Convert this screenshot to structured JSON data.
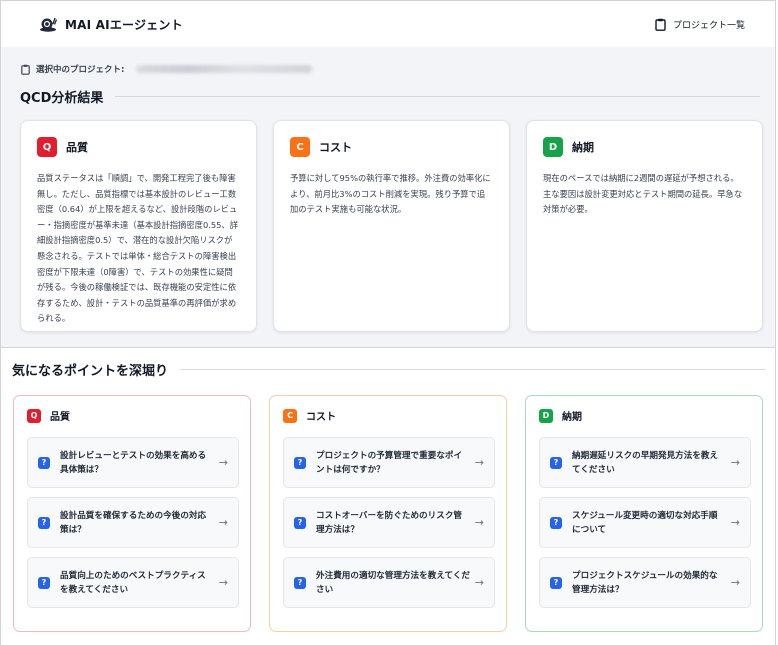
{
  "header": {
    "app_name": "MAI AIエージェント",
    "project_list_label": "プロジェクト一覧"
  },
  "selected_project": {
    "label": "選択中のプロジェクト:"
  },
  "qcd": {
    "title": "QCD分析結果",
    "cards": [
      {
        "badge": "Q",
        "title": "品質",
        "body": "品質ステータスは「順調」で、開発工程完了後も障害無し。ただし、品質指標では基本設計のレビュー工数密度（0.64）が上限を超えるなど、設計段階のレビュー・指摘密度が基準未達（基本設計指摘密度0.55、詳細設計指摘密度0.5）で、潜在的な設計欠陥リスクが懸念される。テストでは単体・総合テストの障害検出密度が下限未達（0障害）で、テストの効果性に疑問が残る。今後の稼働検証では、既存機能の安定性に依存するため、設計・テストの品質基準の再評価が求められる。"
      },
      {
        "badge": "C",
        "title": "コスト",
        "body": "予算に対して95%の執行率で推移。外注費の効率化により、前月比3%のコスト削減を実現。残り予算で追加のテスト実施も可能な状況。"
      },
      {
        "badge": "D",
        "title": "納期",
        "body": "現在のペースでは納期に2週間の遅延が予想される。主な要因は設計変更対応とテスト期間の延長。早急な対策が必要。"
      }
    ]
  },
  "deep_dive": {
    "title": "気になるポイントを深堀り",
    "columns": [
      {
        "badge": "Q",
        "name": "品質",
        "questions": [
          "設計レビューとテストの効果を高める具体策は？",
          "設計品質を確保するための今後の対応策は？",
          "品質向上のためのベストプラクティスを教えてください"
        ]
      },
      {
        "badge": "C",
        "name": "コスト",
        "questions": [
          "プロジェクトの予算管理で重要なポイントは何ですか？",
          "コストオーバーを防ぐためのリスク管理方法は？",
          "外注費用の適切な管理方法を教えてください"
        ]
      },
      {
        "badge": "D",
        "name": "納期",
        "questions": [
          "納期遅延リスクの早期発見方法を教えてください",
          "スケジュール変更時の適切な対応手順について",
          "プロジェクトスケジュールの効果的な管理方法は？"
        ]
      }
    ],
    "question_mark": "?",
    "arrow": "→"
  },
  "colors": {
    "quality": "#e11d2e",
    "cost": "#f97316",
    "delivery": "#16a34a",
    "question_badge": "#2563eb"
  }
}
